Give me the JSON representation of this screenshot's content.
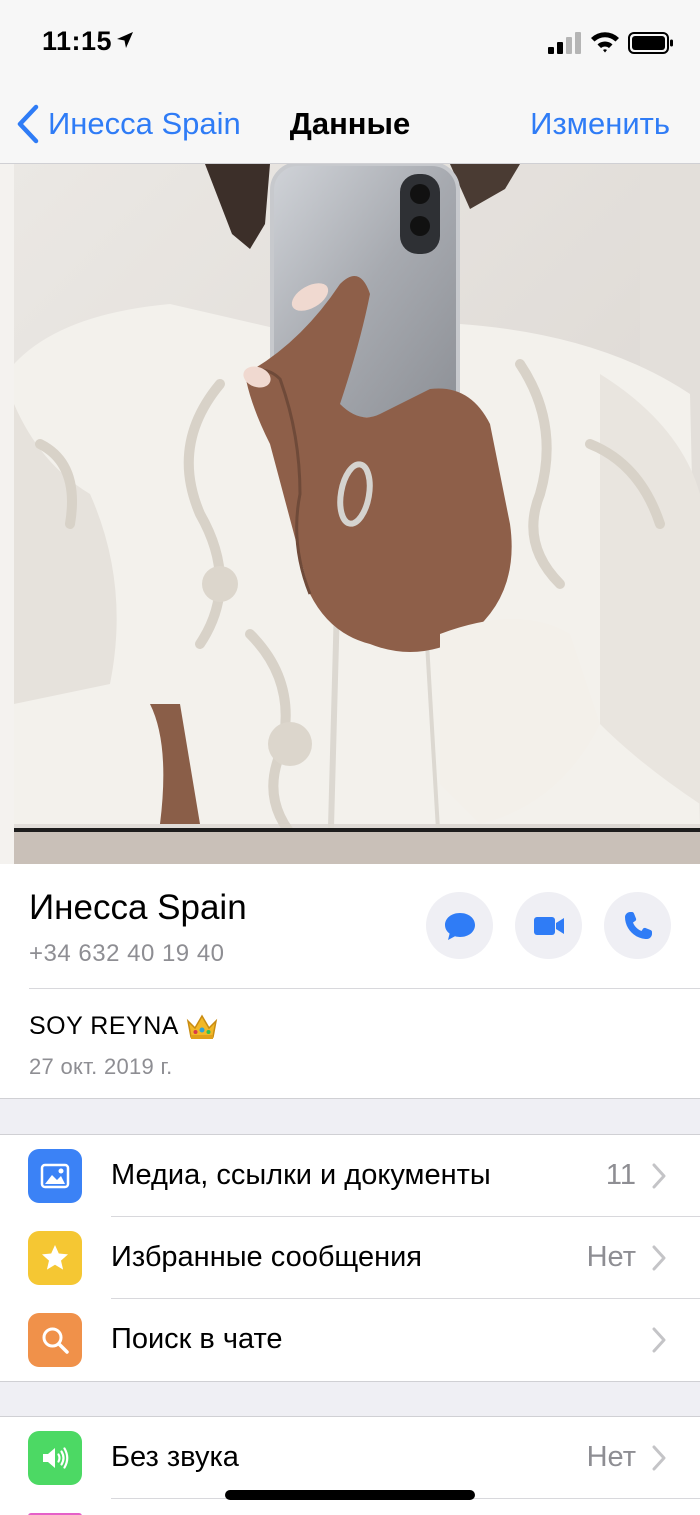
{
  "status_bar": {
    "time": "11:15"
  },
  "nav": {
    "back_label": "Инесса Spain",
    "title": "Данные",
    "edit_label": "Изменить"
  },
  "contact": {
    "name": "Инесса Spain",
    "phone": "+34 632 40 19 40"
  },
  "about": {
    "text": "SOY REYNA",
    "date": "27 окт. 2019 г."
  },
  "menu": [
    {
      "label": "Медиа, ссылки и документы",
      "value": "11",
      "icon": "photo-icon",
      "color": "#3b82f6"
    },
    {
      "label": "Избранные сообщения",
      "value": "Нет",
      "icon": "star-icon",
      "color": "#f5c733"
    },
    {
      "label": "Поиск в чате",
      "value": "",
      "icon": "magnifier-icon",
      "color": "#f0914a"
    }
  ],
  "menu2": [
    {
      "label": "Без звука",
      "value": "Нет",
      "icon": "speaker-icon",
      "color": "#4cd964"
    }
  ],
  "colors": {
    "accent": "#2f7cf6",
    "secondary_text": "#8e8e93",
    "background": "#efeff4"
  }
}
